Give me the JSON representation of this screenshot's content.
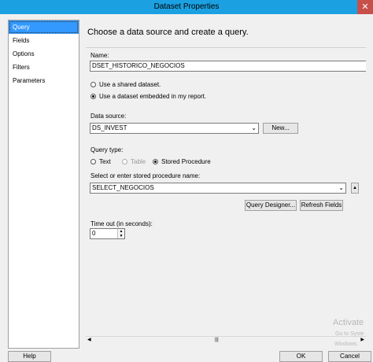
{
  "window": {
    "title": "Dataset Properties",
    "close_label": "✕"
  },
  "nav": {
    "items": [
      {
        "label": "Query"
      },
      {
        "label": "Fields"
      },
      {
        "label": "Options"
      },
      {
        "label": "Filters"
      },
      {
        "label": "Parameters"
      }
    ]
  },
  "main": {
    "heading": "Choose a data source and create a query.",
    "name_label": "Name:",
    "name_value": "DSET_HISTORICO_NEGOCIOS",
    "radio_shared": "Use a shared dataset.",
    "radio_embedded": "Use a dataset embedded in my report.",
    "datasource_label": "Data source:",
    "datasource_value": "DS_INVEST",
    "new_button": "New...",
    "querytype_label": "Query type:",
    "querytype_text": "Text",
    "querytype_table": "Table",
    "querytype_sp": "Stored Procedure",
    "sp_label": "Select or enter stored procedure name:",
    "sp_value": "SELECT_NEGOCIOS",
    "query_designer_button": "Query Designer...",
    "refresh_fields_button": "Refresh Fields",
    "timeout_label": "Time out (in seconds):",
    "timeout_value": "0"
  },
  "watermark": {
    "line1": "Activate",
    "line2": "Go to Syste",
    "line3": "Windows."
  },
  "footer": {
    "help": "Help",
    "ok": "OK",
    "cancel": "Cancel"
  }
}
